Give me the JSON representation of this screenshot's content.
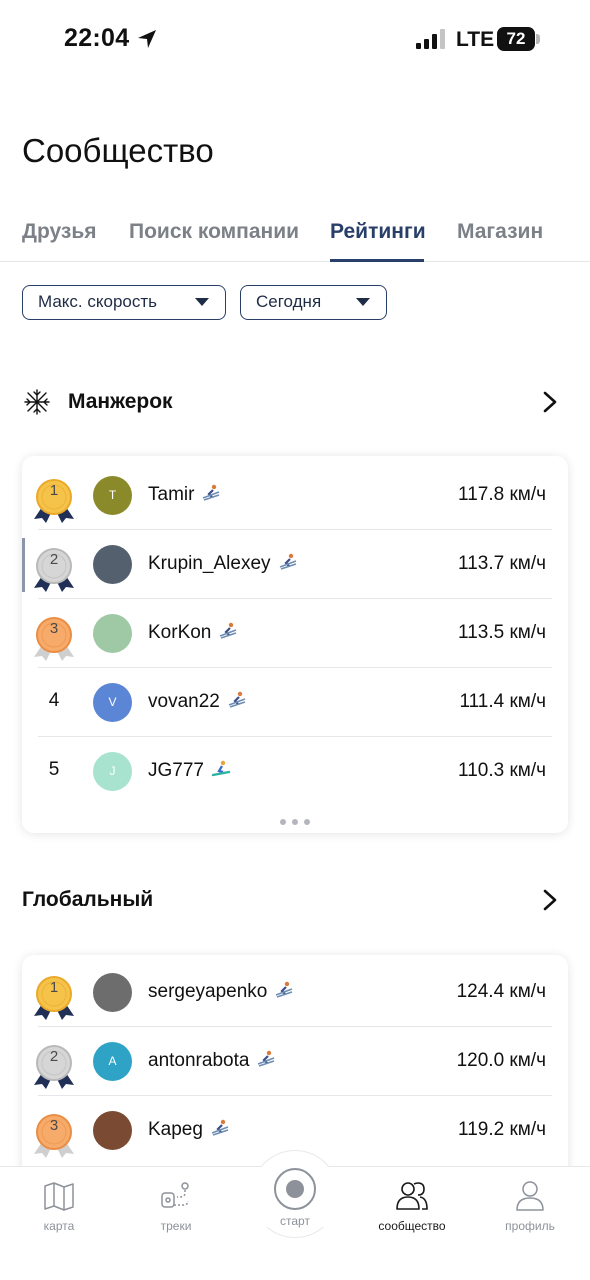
{
  "status_bar": {
    "time": "22:04",
    "network": "LTE",
    "battery": "72"
  },
  "page_title": "Сообщество",
  "tabs": [
    {
      "label": "Друзья",
      "active": false
    },
    {
      "label": "Поиск компании",
      "active": false
    },
    {
      "label": "Рейтинги",
      "active": true
    },
    {
      "label": "Магазин",
      "active": false
    }
  ],
  "filters": {
    "metric": "Макс. скорость",
    "period": "Сегодня"
  },
  "resort_section": {
    "title": "Манжерок",
    "icon": "snowflake-icon",
    "rows": [
      {
        "rank": "1",
        "medal": "gold",
        "avatar_letter": "T",
        "avatar_color": "#8a8a2a",
        "name": "Tamir",
        "sport": "ski-icon",
        "speed": "117.8 км/ч"
      },
      {
        "rank": "2",
        "medal": "silver",
        "avatar_letter": "",
        "avatar_color": "#55606e",
        "name": "Krupin_Alexey",
        "sport": "ski-icon",
        "speed": "113.7 км/ч",
        "highlight": true
      },
      {
        "rank": "3",
        "medal": "bronze",
        "avatar_letter": "",
        "avatar_color": "#9fc8a4",
        "name": "KorKon",
        "sport": "ski-icon",
        "speed": "113.5 км/ч"
      },
      {
        "rank": "4",
        "medal": "",
        "avatar_letter": "V",
        "avatar_color": "#5b86d6",
        "name": "vovan22",
        "sport": "ski-icon",
        "speed": "111.4 км/ч"
      },
      {
        "rank": "5",
        "medal": "",
        "avatar_letter": "J",
        "avatar_color": "#a7e3cf",
        "name": "JG777",
        "sport": "snowboard-icon",
        "speed": "110.3 км/ч"
      }
    ]
  },
  "global_section": {
    "title": "Глобальный",
    "rows": [
      {
        "rank": "1",
        "medal": "gold",
        "avatar_letter": "",
        "avatar_color": "#6d6d6d",
        "name": "sergeyapenko",
        "sport": "ski-icon",
        "speed": "124.4 км/ч"
      },
      {
        "rank": "2",
        "medal": "silver",
        "avatar_letter": "A",
        "avatar_color": "#2ea3c6",
        "name": "antonrabota",
        "sport": "ski-icon",
        "speed": "120.0 км/ч"
      },
      {
        "rank": "3",
        "medal": "bronze",
        "avatar_letter": "",
        "avatar_color": "#7a4a33",
        "name": "Kapeg",
        "sport": "ski-icon",
        "speed": "119.2 км/ч"
      }
    ]
  },
  "bottom_nav": [
    {
      "label": "карта",
      "icon": "map-icon",
      "active": false
    },
    {
      "label": "треки",
      "icon": "tracks-icon",
      "active": false
    },
    {
      "label": "старт",
      "icon": "record-icon",
      "active": false
    },
    {
      "label": "сообщество",
      "icon": "community-icon",
      "active": true
    },
    {
      "label": "профиль",
      "icon": "profile-icon",
      "active": false
    }
  ],
  "colors": {
    "accent": "#283f6a",
    "gold": "#f5c24a",
    "silver": "#d6d6d6",
    "bronze": "#f7ab6a",
    "ribbon": "#1f2f55"
  }
}
